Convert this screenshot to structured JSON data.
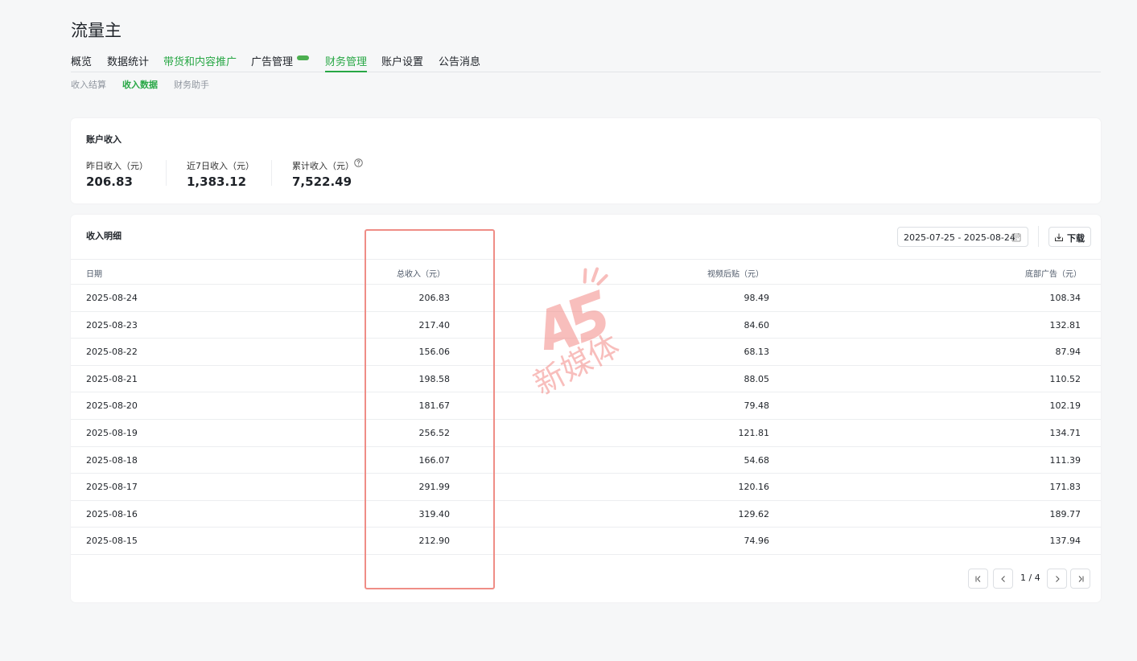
{
  "app": {
    "title": "流量主"
  },
  "nav": {
    "tabs": [
      {
        "label": "概览"
      },
      {
        "label": "数据统计"
      },
      {
        "label": "带货和内容推广"
      },
      {
        "label": "广告管理"
      },
      {
        "label": "财务管理"
      },
      {
        "label": "账户设置"
      },
      {
        "label": "公告消息"
      }
    ],
    "active_tab": "财务管理",
    "subtabs": [
      {
        "label": "收入结算"
      },
      {
        "label": "收入数据"
      },
      {
        "label": "财务助手"
      }
    ],
    "active_subtab": "收入数据"
  },
  "account_income": {
    "title": "账户收入",
    "stats": [
      {
        "label": "昨日收入（元）",
        "value": "206.83"
      },
      {
        "label": "近7日收入（元）",
        "value": "1,383.12"
      },
      {
        "label": "累计收入（元）",
        "value": "7,522.49"
      }
    ]
  },
  "income_detail": {
    "title": "收入明细",
    "date_range": "2025-07-25 - 2025-08-24",
    "download_label": "下载",
    "columns": [
      "日期",
      "总收入（元）",
      "视频后贴（元）",
      "底部广告（元）"
    ],
    "rows": [
      {
        "date": "2025-08-24",
        "total": "206.83",
        "video": "98.49",
        "bottom": "108.34"
      },
      {
        "date": "2025-08-23",
        "total": "217.40",
        "video": "84.60",
        "bottom": "132.81"
      },
      {
        "date": "2025-08-22",
        "total": "156.06",
        "video": "68.13",
        "bottom": "87.94"
      },
      {
        "date": "2025-08-21",
        "total": "198.58",
        "video": "88.05",
        "bottom": "110.52"
      },
      {
        "date": "2025-08-20",
        "total": "181.67",
        "video": "79.48",
        "bottom": "102.19"
      },
      {
        "date": "2025-08-19",
        "total": "256.52",
        "video": "121.81",
        "bottom": "134.71"
      },
      {
        "date": "2025-08-18",
        "total": "166.07",
        "video": "54.68",
        "bottom": "111.39"
      },
      {
        "date": "2025-08-17",
        "total": "291.99",
        "video": "120.16",
        "bottom": "171.83"
      },
      {
        "date": "2025-08-16",
        "total": "319.40",
        "video": "129.62",
        "bottom": "189.77"
      },
      {
        "date": "2025-08-15",
        "total": "212.90",
        "video": "74.96",
        "bottom": "137.94"
      }
    ],
    "pagination": {
      "text": "1 / 4"
    }
  },
  "watermark": {
    "brand": "A5",
    "text": "新媒体"
  },
  "colors": {
    "accent": "#28a745",
    "highlight": "#ef8d86",
    "watermark": "#f38a86"
  }
}
